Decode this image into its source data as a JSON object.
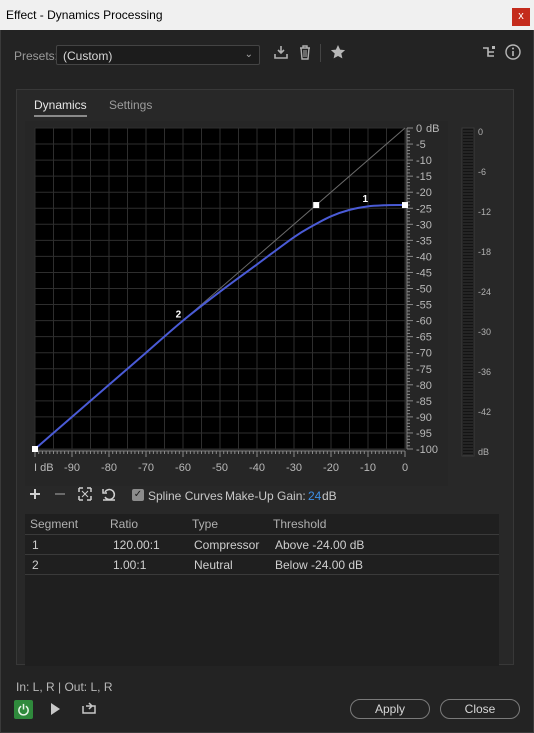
{
  "window": {
    "title": "Effect - Dynamics Processing",
    "close_glyph": "x"
  },
  "presets": {
    "label": "Presets:",
    "value": "(Custom)",
    "icons": [
      "save-preset-icon",
      "delete-icon",
      "favorite-star-icon",
      "routing-icon",
      "info-icon"
    ]
  },
  "tabs": [
    {
      "label": "Dynamics",
      "active": true
    },
    {
      "label": "Settings",
      "active": false
    }
  ],
  "graph": {
    "x_unit": "dB",
    "y_unit": "dB",
    "x_ticks": [
      "-90",
      "-80",
      "-70",
      "-60",
      "-50",
      "-40",
      "-30",
      "-20",
      "-10",
      "0"
    ],
    "y_ticks": [
      "0",
      "-5",
      "-10",
      "-15",
      "-20",
      "-25",
      "-30",
      "-35",
      "-40",
      "-45",
      "-50",
      "-55",
      "-60",
      "-65",
      "-70",
      "-75",
      "-80",
      "-85",
      "-90",
      "-95",
      "-100"
    ],
    "point_labels": [
      "1",
      "2"
    ],
    "curve_color": "#4a5bd6",
    "curve": [
      [
        -100,
        -100
      ],
      [
        -90,
        -90
      ],
      [
        -80,
        -80
      ],
      [
        -70,
        -70
      ],
      [
        -60,
        -60
      ],
      [
        -50,
        -51
      ],
      [
        -40,
        -42.5
      ],
      [
        -30,
        -34
      ],
      [
        -25,
        -30.5
      ],
      [
        -20,
        -27.5
      ],
      [
        -15,
        -25.5
      ],
      [
        -10,
        -24.4
      ],
      [
        -5,
        -24.05
      ],
      [
        0,
        -24
      ]
    ],
    "control_points": [
      [
        -100,
        -100
      ],
      [
        -24,
        -24
      ],
      [
        0,
        -24
      ]
    ]
  },
  "meter": {
    "ticks": [
      "0",
      "-6",
      "-12",
      "-18",
      "-24",
      "-30",
      "-36",
      "-42",
      "dB"
    ]
  },
  "toolbar": {
    "icons": [
      "add-icon",
      "remove-icon",
      "fit-icon",
      "reset-icon"
    ],
    "spline_label": "Spline Curves",
    "spline_checked": true,
    "makeup_label": "Make-Up Gain:",
    "makeup_value": "24",
    "makeup_unit": "dB"
  },
  "segments": {
    "columns": [
      "Segment",
      "Ratio",
      "Type",
      "Threshold"
    ],
    "rows": [
      [
        "1",
        "120.00:1",
        "Compressor",
        "Above -24.00 dB"
      ],
      [
        "2",
        "1.00:1",
        "Neutral",
        "Below -24.00 dB"
      ]
    ]
  },
  "footer": {
    "io": "In: L, R | Out: L, R",
    "apply": "Apply",
    "close": "Close",
    "power_color": "#2f8a3c"
  }
}
